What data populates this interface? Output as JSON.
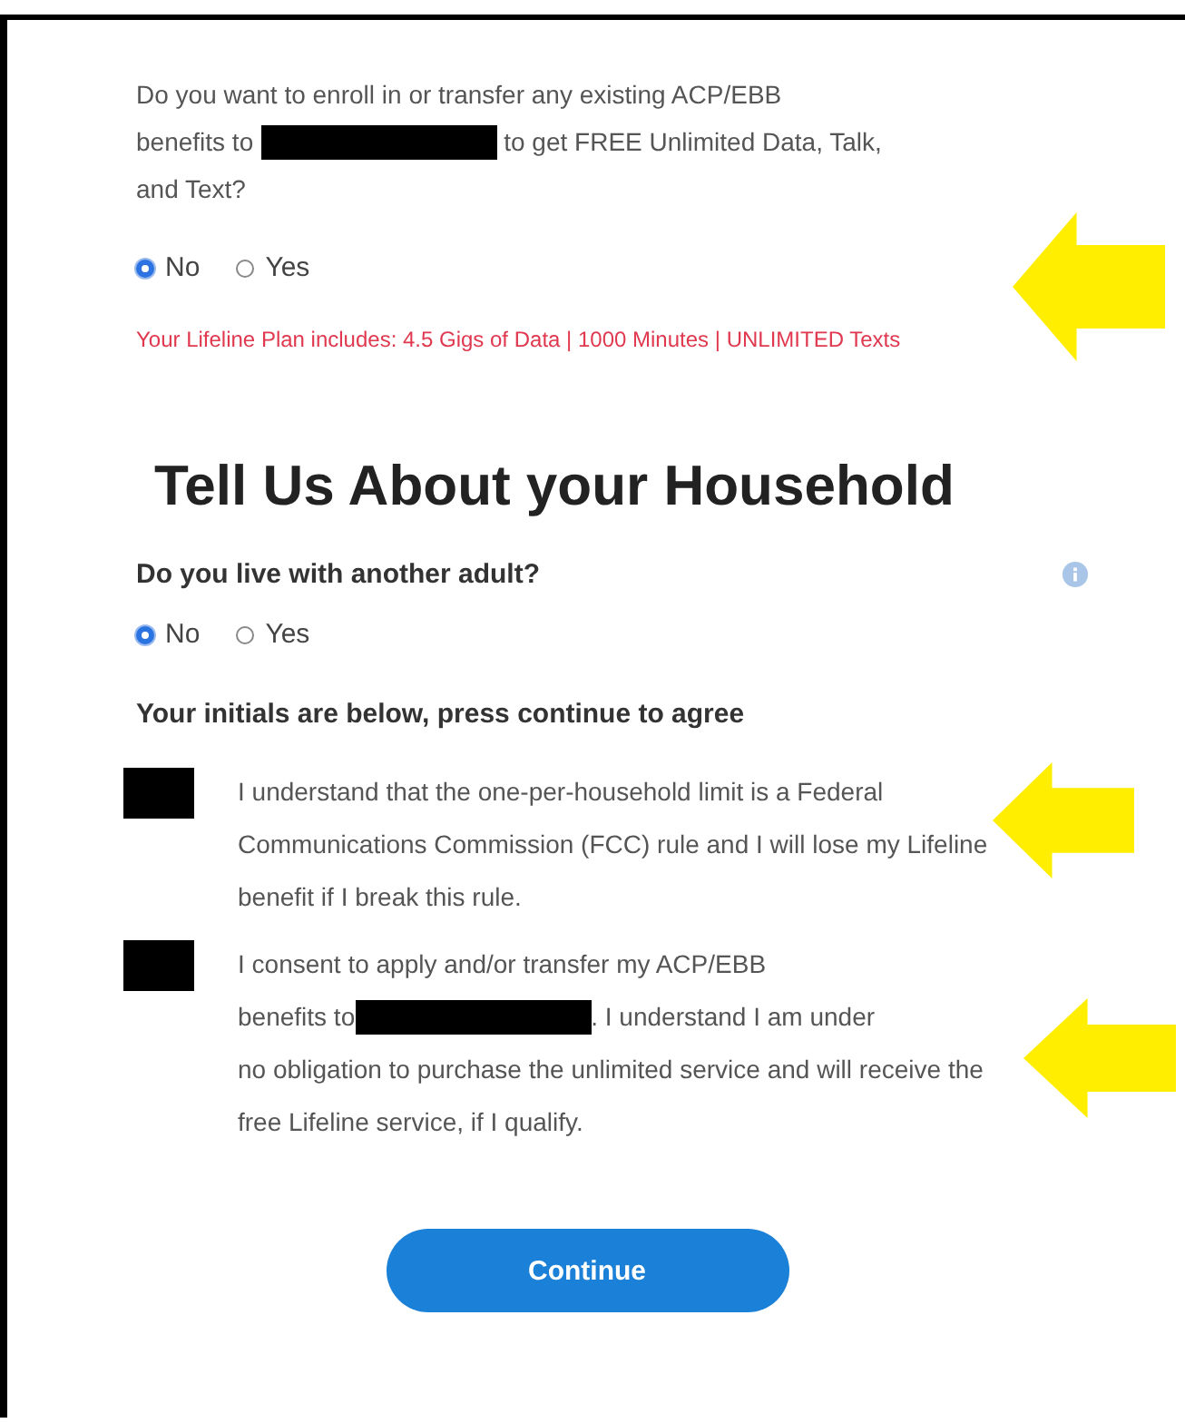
{
  "benefits_question": {
    "line_1": "Do you want to enroll in or transfer any existing ACP/EBB",
    "before_redaction": "benefits to",
    "after_redaction": "to get FREE Unlimited Data, Talk,",
    "continuation": "and Text?"
  },
  "benefits_options": [
    {
      "label": "No",
      "selected": true
    },
    {
      "label": "Yes",
      "selected": false
    }
  ],
  "plan_note": "Your Lifeline Plan includes: 4.5 Gigs of Data | 1000 Minutes | UNLIMITED Texts",
  "heading": "Tell Us About your Household",
  "household_question": "Do you live with another adult?",
  "household_options": [
    {
      "label": "No",
      "selected": true
    },
    {
      "label": "Yes",
      "selected": false
    }
  ],
  "initials_prompt": "Your initials are below, press continue to agree",
  "agreements": [
    {
      "text_before": "I understand that the one-per-household limit is a Federal Communications Commission (FCC) rule and I will lose my Lifeline benefit if I break this rule."
    },
    {
      "line_1": "I consent to apply and/or transfer my ACP/EBB",
      "before_redaction": "benefits to",
      "after_redaction": ". I understand I am under",
      "continuation": "no obligation to purchase the unlimited service and will receive the free Lifeline service, if I qualify."
    }
  ],
  "continue_button": "Continue"
}
